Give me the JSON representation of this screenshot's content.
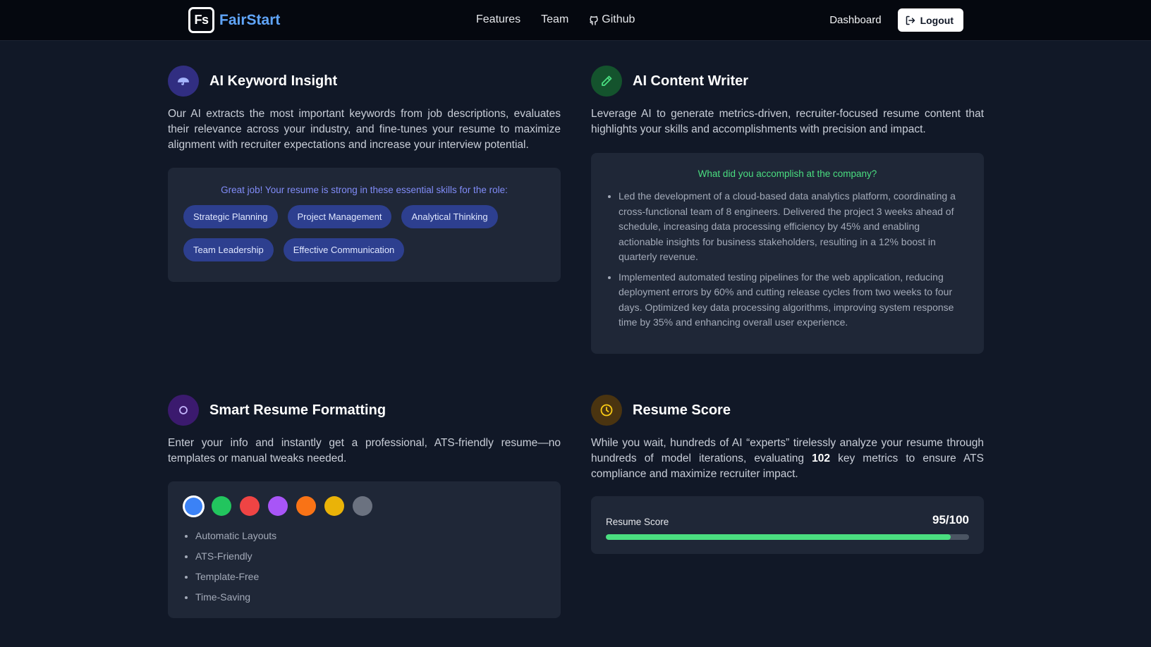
{
  "nav": {
    "logo_mark": "Fs",
    "brand": "FairStart",
    "links": [
      {
        "label": "Features"
      },
      {
        "label": "Team"
      },
      {
        "label": "Github",
        "icon": "github-icon"
      }
    ],
    "dashboard": "Dashboard",
    "logout": "Logout"
  },
  "keyword_insight": {
    "title": "AI Keyword Insight",
    "icon": "umbrella-icon",
    "description": "Our AI extracts the most important keywords from job descriptions, evaluates their relevance across your industry, and fine-tunes your resume to maximize alignment with recruiter expectations and increase your interview potential.",
    "card_heading": "Great job! Your resume is strong in these essential skills for the role:",
    "skills": [
      "Strategic Planning",
      "Project Management",
      "Analytical Thinking",
      "Team Leadership",
      "Effective Communication"
    ]
  },
  "content_writer": {
    "title": "AI Content Writer",
    "icon": "pencil-icon",
    "description": "Leverage AI to generate metrics-driven, recruiter-focused resume content that highlights your skills and accomplishments with precision and impact.",
    "question": "What did you accomplish at the company?",
    "bullets": [
      "Led the development of a cloud-based data analytics platform, coordinating a cross-functional team of 8 engineers. Delivered the project 3 weeks ahead of schedule, increasing data processing efficiency by 45% and enabling actionable insights for business stakeholders, resulting in a 12% boost in quarterly revenue.",
      "Implemented automated testing pipelines for the web application, reducing deployment errors by 60% and cutting release cycles from two weeks to four days. Optimized key data processing algorithms, improving system response time by 35% and enhancing overall user experience."
    ]
  },
  "formatting": {
    "title": "Smart Resume Formatting",
    "icon": "circle-icon",
    "description": "Enter your info and instantly get a professional, ATS-friendly resume—no templates or manual tweaks needed.",
    "swatches": [
      "#3b82f6",
      "#22c55e",
      "#ef4444",
      "#a855f7",
      "#f97316",
      "#eab308",
      "#6b7280"
    ],
    "selected_swatch": 0,
    "features": [
      "Automatic Layouts",
      "ATS-Friendly",
      "Template-Free",
      "Time-Saving"
    ]
  },
  "resume_score": {
    "title": "Resume Score",
    "icon": "clock-icon",
    "description_before": "While you wait, hundreds of AI “experts” tirelessly analyze your resume through hundreds of model iterations, evaluating ",
    "metric_count": "102",
    "description_after": " key metrics to ensure ATS compliance and maximize recruiter impact.",
    "score_label": "Resume Score",
    "score_text": "95/100",
    "score_fraction": 0.95
  },
  "colors": {
    "background": "#111827",
    "card": "#1f2737",
    "brand": "#60a5fa",
    "chip": "#2d3f8f",
    "accent_green": "#4ade80"
  }
}
